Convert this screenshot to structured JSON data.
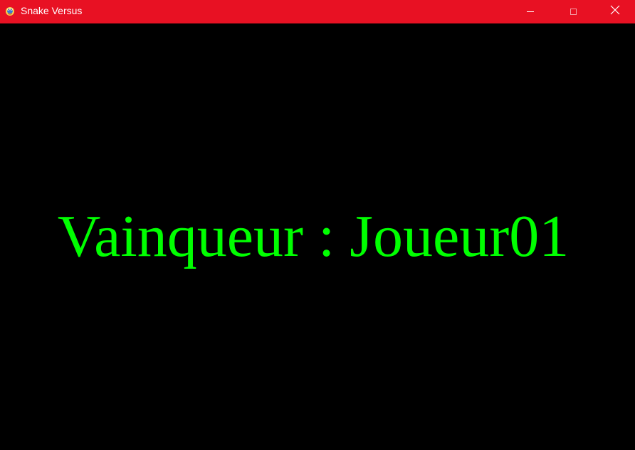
{
  "window": {
    "title": "Snake Versus",
    "icon": "python-snake-icon",
    "titlebar_color": "#e81123",
    "controls": {
      "minimize_icon": "minimize-icon",
      "maximize_icon": "maximize-icon",
      "close_icon": "close-icon"
    }
  },
  "game": {
    "background_color": "#000000",
    "winner_message": "Vainqueur : Joueur01",
    "text_color": "#00ff00"
  }
}
